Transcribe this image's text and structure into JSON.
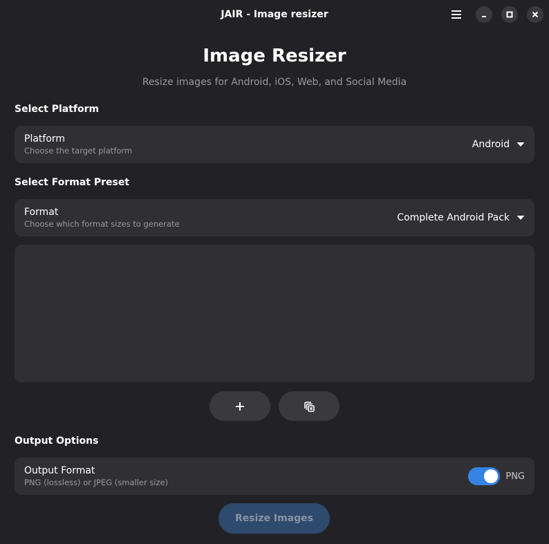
{
  "window": {
    "title": "JAIR - Image resizer"
  },
  "header": {
    "title": "Image Resizer",
    "subtitle": "Resize images for Android, iOS, Web, and Social Media"
  },
  "platform_section": {
    "heading": "Select Platform",
    "row_title": "Platform",
    "row_subtitle": "Choose the target platform",
    "selected": "Android"
  },
  "format_section": {
    "heading": "Select Format Preset",
    "row_title": "Format",
    "row_subtitle": "Choose which format sizes to generate",
    "selected": "Complete Android Pack"
  },
  "image_actions": {
    "add_icon": "plus-icon",
    "clear_icon": "clear-images-icon"
  },
  "output_section": {
    "heading": "Output Options",
    "row_title": "Output Format",
    "row_subtitle": "PNG (lossless) or JPEG (smaller size)",
    "toggle_on": true,
    "toggle_label": "PNG"
  },
  "actions": {
    "resize_label": "Resize Images"
  },
  "colors": {
    "background": "#222226",
    "card": "#303034",
    "accent": "#3584e4",
    "primary_disabled": "#2e4a6d"
  }
}
